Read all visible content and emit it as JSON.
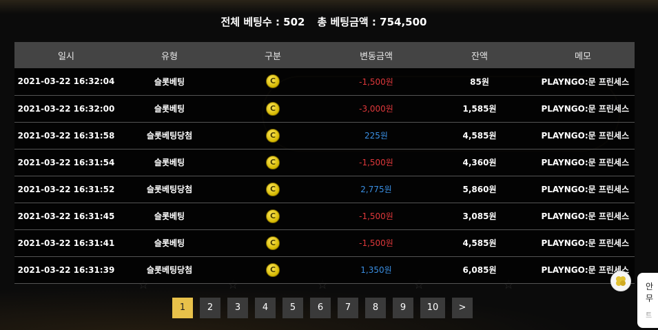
{
  "summary": {
    "total_bets_label": "전체 베팅수 : 502",
    "total_amount_label": "총 베팅금액 : 754,500"
  },
  "table": {
    "headers": [
      "일시",
      "유형",
      "구분",
      "변동금액",
      "잔액",
      "메모"
    ],
    "rows": [
      {
        "datetime": "2021-03-22 16:32:04",
        "type": "슬롯베팅",
        "icon": "coin-icon",
        "change": "-1,500원",
        "change_sign": "neg",
        "balance": "85원",
        "memo": "PLAYNGO:문 프린세스"
      },
      {
        "datetime": "2021-03-22 16:32:00",
        "type": "슬롯베팅",
        "icon": "coin-icon",
        "change": "-3,000원",
        "change_sign": "neg",
        "balance": "1,585원",
        "memo": "PLAYNGO:문 프린세스"
      },
      {
        "datetime": "2021-03-22 16:31:58",
        "type": "슬롯베팅당첨",
        "icon": "coin-icon",
        "change": "225원",
        "change_sign": "pos",
        "balance": "4,585원",
        "memo": "PLAYNGO:문 프린세스"
      },
      {
        "datetime": "2021-03-22 16:31:54",
        "type": "슬롯베팅",
        "icon": "coin-icon",
        "change": "-1,500원",
        "change_sign": "neg",
        "balance": "4,360원",
        "memo": "PLAYNGO:문 프린세스"
      },
      {
        "datetime": "2021-03-22 16:31:52",
        "type": "슬롯베팅당첨",
        "icon": "coin-icon",
        "change": "2,775원",
        "change_sign": "pos",
        "balance": "5,860원",
        "memo": "PLAYNGO:문 프린세스"
      },
      {
        "datetime": "2021-03-22 16:31:45",
        "type": "슬롯베팅",
        "icon": "coin-icon",
        "change": "-1,500원",
        "change_sign": "neg",
        "balance": "3,085원",
        "memo": "PLAYNGO:문 프린세스"
      },
      {
        "datetime": "2021-03-22 16:31:41",
        "type": "슬롯베팅",
        "icon": "coin-icon",
        "change": "-1,500원",
        "change_sign": "neg",
        "balance": "4,585원",
        "memo": "PLAYNGO:문 프린세스"
      },
      {
        "datetime": "2021-03-22 16:31:39",
        "type": "슬롯베팅당첨",
        "icon": "coin-icon",
        "change": "1,350원",
        "change_sign": "pos",
        "balance": "6,085원",
        "memo": "PLAYNGO:문 프린세스"
      }
    ]
  },
  "pagination": {
    "pages": [
      "1",
      "2",
      "3",
      "4",
      "5",
      "6",
      "7",
      "8",
      "9",
      "10"
    ],
    "active": "1",
    "next_label": ">"
  },
  "chat": {
    "line1": "안",
    "line2": "무",
    "sub": "트"
  },
  "colors": {
    "negative": "#e0383b",
    "positive": "#3a8fe3",
    "active_page": "#e8c14a",
    "header_bg": "#444444"
  }
}
